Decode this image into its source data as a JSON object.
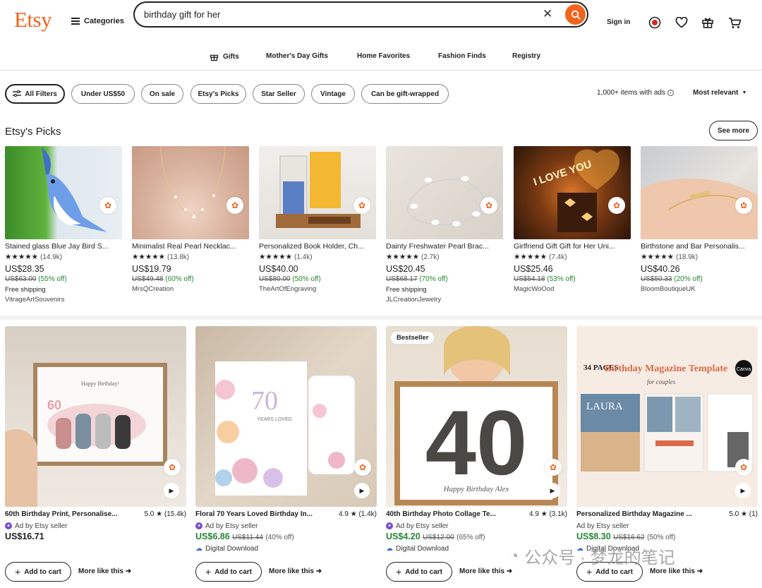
{
  "header": {
    "logo": "Etsy",
    "categories_label": "Categories",
    "search_value": "birthday gift for her",
    "sign_in": "Sign in"
  },
  "nav": [
    "Gifts",
    "Mother's Day Gifts",
    "Home Favorites",
    "Fashion Finds",
    "Registry"
  ],
  "filters": {
    "chips": [
      "All Filters",
      "Under US$50",
      "On sale",
      "Etsy's Picks",
      "Star Seller",
      "Vintage",
      "Can be gift-wrapped"
    ],
    "results_text": "1,000+ items with ads",
    "sort_label": "Most relevant"
  },
  "picks": {
    "heading": "Etsy's Picks",
    "see_more": "See more",
    "items": [
      {
        "title": "Stained glass Blue Jay Bird S...",
        "rating_count": "(14.9k)",
        "price": "US$28.35",
        "old_price": "US$63.00",
        "discount": "(55% off)",
        "free_shipping": "Free shipping",
        "shop": "VitrageArtSouvenirs"
      },
      {
        "title": "Minimalist Real Pearl Necklac...",
        "rating_count": "(13.8k)",
        "price": "US$19.79",
        "old_price": "US$49.48",
        "discount": "(60% off)",
        "free_shipping": "",
        "shop": "MrsQCreation"
      },
      {
        "title": "Personalized Book Holder, Ch...",
        "rating_count": "(1.4k)",
        "price": "US$40.00",
        "old_price": "US$80.00",
        "discount": "(50% off)",
        "free_shipping": "",
        "shop": "TheArtOfEngraving"
      },
      {
        "title": "Dainty Freshwater Pearl Brac...",
        "rating_count": "(2.7k)",
        "price": "US$20.45",
        "old_price": "US$68.17",
        "discount": "(70% off)",
        "free_shipping": "Free shipping",
        "shop": "JLCreationJewelry"
      },
      {
        "title": "Girlfriend Gift Gift for Her Uni...",
        "rating_count": "(7.4k)",
        "price": "US$25.46",
        "old_price": "US$54.18",
        "discount": "(53% off)",
        "free_shipping": "",
        "shop": "MagicWoOod"
      },
      {
        "title": "Birthstone and Bar Personalis...",
        "rating_count": "(18.9k)",
        "price": "US$40.26",
        "old_price": "US$50.33",
        "discount": "(20% off)",
        "free_shipping": "",
        "shop": "BloomBoutiqueUK"
      }
    ]
  },
  "ads": {
    "ad_by": "Ad by Etsy seller",
    "add_to_cart": "Add to cart",
    "more_like_this": "More like this",
    "digital_download": "Digital Download",
    "items": [
      {
        "title": "60th Birthday Print, Personalise...",
        "rating": "5.0 ★ (15.4k)",
        "price": "US$16.71",
        "old_price": "",
        "discount": "",
        "badge": "",
        "image_text": [
          "Happy Birthday!",
          "60"
        ]
      },
      {
        "title": "Floral 70 Years Loved Birthday In...",
        "rating": "4.9 ★ (1.4k)",
        "price": "US$6.86",
        "old_price": "US$11.44",
        "discount": "(40% off)",
        "badge": "",
        "image_text": [
          "70",
          "YEARS LOVED"
        ]
      },
      {
        "title": "40th Birthday Photo Collage Te...",
        "rating": "4.9 ★ (3.1k)",
        "price": "US$4.20",
        "old_price": "US$12.00",
        "discount": "(65% off)",
        "badge": "Bestseller",
        "image_text": [
          "40",
          "Happy Birthday Alex"
        ]
      },
      {
        "title": "Personalized Birthday Magazine ...",
        "rating": "5.0 ★ (1)",
        "price": "US$8.30",
        "old_price": "US$16.62",
        "discount": "(50% off)",
        "badge": "",
        "image_text": [
          "34 PAGES",
          "Birthday Magazine Template",
          "for couples",
          "Canva",
          "LAURA"
        ]
      }
    ]
  },
  "watermark": "公众号 · 梦龙的笔记",
  "colors": {
    "accent": "#f1641e",
    "sale_green": "#258635",
    "text": "#222222"
  }
}
